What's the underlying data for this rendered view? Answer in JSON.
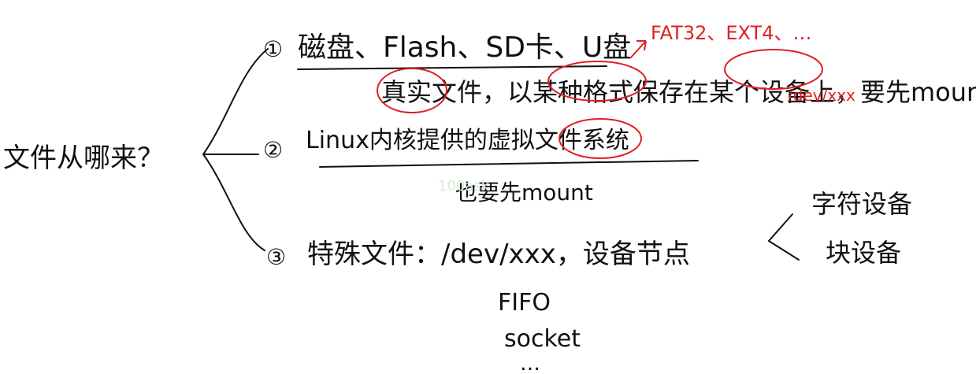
{
  "root": {
    "label": "文件从哪来？"
  },
  "branches": [
    {
      "number": "①",
      "title": "磁盘、Flash、SD卡、U盘",
      "detail": "真实文件，以某种格式保存在某个设备上，要先mount",
      "annotation_format": "FAT32、EXT4、…",
      "annotation_device": "/dev/xxx"
    },
    {
      "number": "②",
      "title": "Linux内核提供的虚拟文件系统",
      "detail": "也要先mount"
    },
    {
      "number": "③",
      "title": "特殊文件：/dev/xxx，设备节点",
      "device_types": [
        "字符设备",
        "块设备"
      ],
      "others": [
        "FIFO",
        "socket",
        "…"
      ]
    }
  ],
  "watermark": "100ask"
}
